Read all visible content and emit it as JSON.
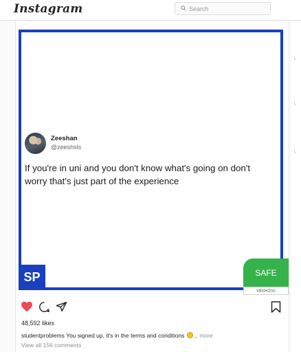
{
  "app": {
    "logo": "Instagram"
  },
  "search": {
    "placeholder": "Search"
  },
  "post": {
    "tweet": {
      "name": "Zeeshan",
      "handle": "@zeeshsls",
      "text": "If you're in uni and you don't know what's going on don't worry that's just part of the experience"
    },
    "brand_badge": "SP",
    "safe_badge": {
      "label": "SAFE",
      "code": "v8nH2ns"
    },
    "likes": "48,592 likes",
    "caption": {
      "username": "studentproblems",
      "text": "You signed up, it's in the terms and conditions",
      "ellipsis": "...",
      "more": "more"
    },
    "comments_link": "View all 156 comments"
  },
  "colors": {
    "frame_blue": "#1a3fbf",
    "safe_green": "#36b24a",
    "like_red": "#ed4956"
  },
  "icons": [
    "search-icon",
    "heart-icon",
    "comment-icon",
    "share-icon",
    "bookmark-icon",
    "emoji-icon"
  ]
}
